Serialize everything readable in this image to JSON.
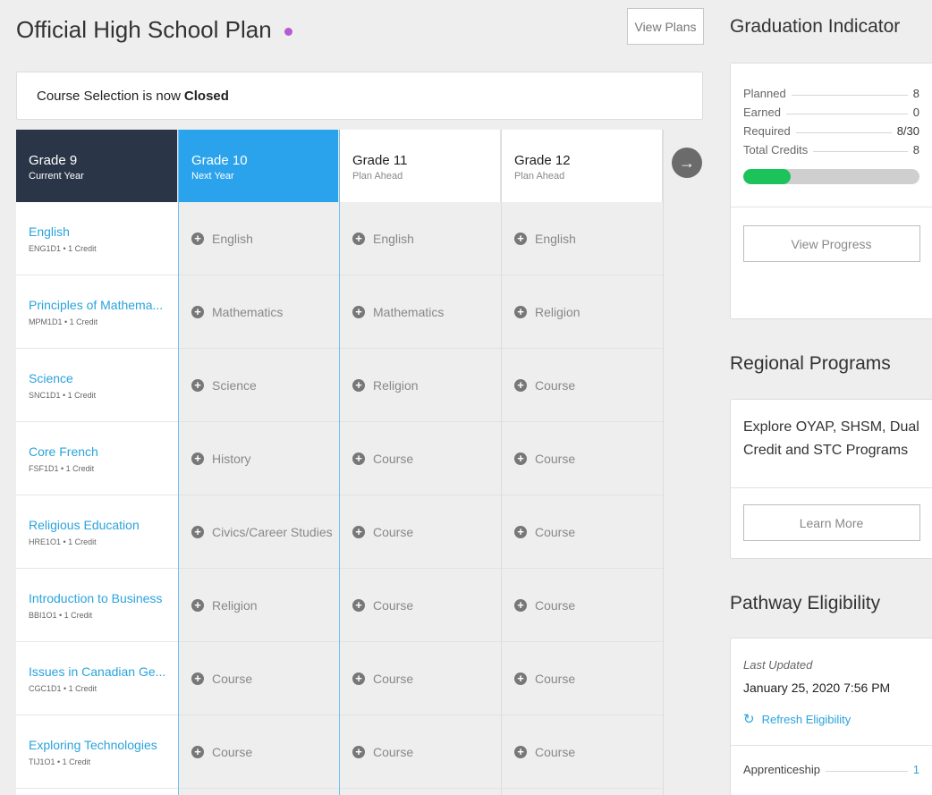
{
  "header": {
    "title": "Official High School Plan",
    "view_plans_label": "View Plans"
  },
  "notice": {
    "prefix": "Course Selection is now",
    "status": "Closed"
  },
  "grades": [
    {
      "name": "Grade 9",
      "sub": "Current Year",
      "courses": [
        {
          "title": "English",
          "code": "ENG1D1 • 1 Credit"
        },
        {
          "title": "Principles of Mathema...",
          "code": "MPM1D1 • 1 Credit"
        },
        {
          "title": "Science",
          "code": "SNC1D1 • 1 Credit"
        },
        {
          "title": "Core French",
          "code": "FSF1D1 • 1 Credit"
        },
        {
          "title": "Religious Education",
          "code": "HRE1O1 • 1 Credit"
        },
        {
          "title": "Introduction to Business",
          "code": "BBI1O1 • 1 Credit"
        },
        {
          "title": "Issues in Canadian Ge...",
          "code": "CGC1D1 • 1 Credit"
        },
        {
          "title": "Exploring Technologies",
          "code": "TIJ1O1 • 1 Credit"
        }
      ]
    },
    {
      "name": "Grade 10",
      "sub": "Next Year",
      "slots": [
        "English",
        "Mathematics",
        "Science",
        "History",
        "Civics/Career Studies",
        "Religion",
        "Course",
        "Course"
      ]
    },
    {
      "name": "Grade 11",
      "sub": "Plan Ahead",
      "slots": [
        "English",
        "Mathematics",
        "Religion",
        "Course",
        "Course",
        "Course",
        "Course",
        "Course"
      ]
    },
    {
      "name": "Grade 12",
      "sub": "Plan Ahead",
      "slots": [
        "English",
        "Religion",
        "Course",
        "Course",
        "Course",
        "Course",
        "Course",
        "Course"
      ]
    }
  ],
  "next_arrow": "→",
  "graduation": {
    "title": "Graduation Indicator",
    "stats": [
      {
        "label": "Planned",
        "value": "8"
      },
      {
        "label": "Earned",
        "value": "0"
      },
      {
        "label": "Required",
        "value": "8/30"
      },
      {
        "label": "Total Credits",
        "value": "8"
      }
    ],
    "progress_fraction": 0.27,
    "progress_color": "#1cc35a",
    "button_label": "View Progress"
  },
  "regional": {
    "title": "Regional Programs",
    "text": "Explore OYAP, SHSM, Dual Credit and STC Programs",
    "button_label": "Learn More"
  },
  "pathway": {
    "title": "Pathway Eligibility",
    "last_updated_label": "Last Updated",
    "date": "January 25, 2020 7:56 PM",
    "refresh_label": "Refresh Eligibility",
    "refresh_icon": "↻",
    "rows": [
      {
        "label": "Apprenticeship",
        "value": "1"
      }
    ]
  },
  "colors": {
    "accent": "#2aa3dc",
    "grade9_header": "#2a3647",
    "grade10_header": "#2aa3ec",
    "status_dot": "#b65bd2"
  }
}
